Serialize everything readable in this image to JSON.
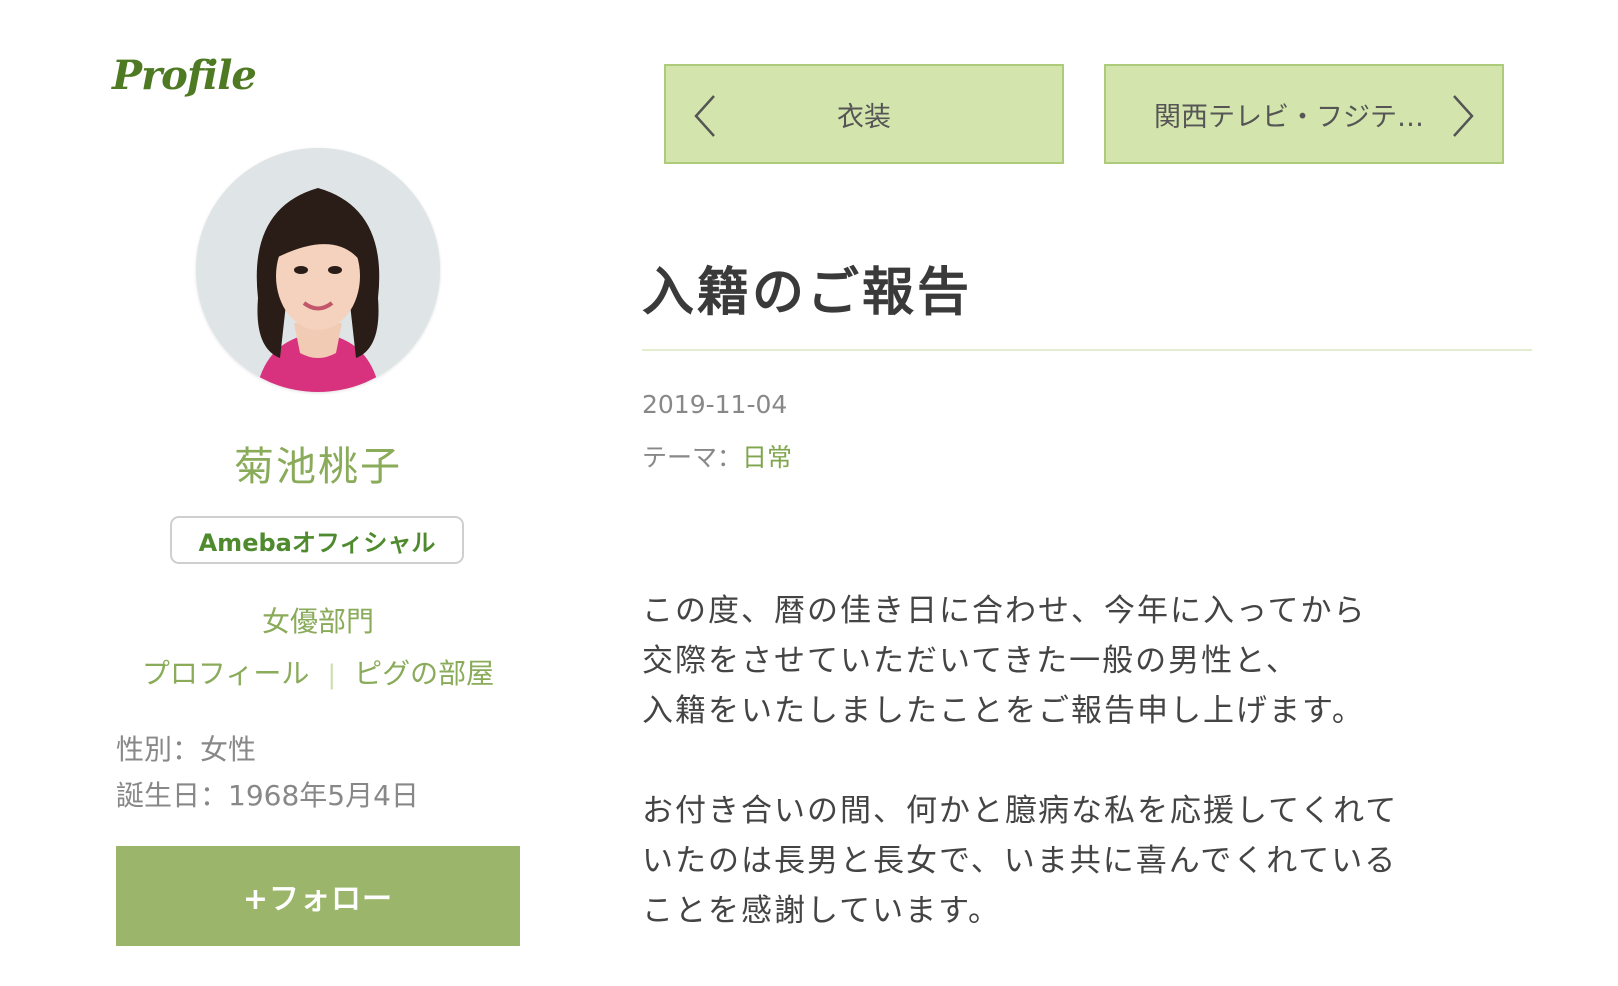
{
  "sidebar": {
    "heading": "Profile",
    "blog_name": "菊池桃子",
    "official_badge": "Amebaオフィシャル",
    "category": "女優部門",
    "links": [
      "プロフィール",
      "ピグの部屋"
    ],
    "gender": "性別：女性",
    "birthday": "誕生日：1968年5月4日",
    "follow_button": "+フォロー"
  },
  "navigation": {
    "prev_title": "衣装",
    "next_title": "関西テレビ・フジテ…",
    "prev_icon": "chevron-left-icon",
    "next_icon": "chevron-right-icon"
  },
  "article": {
    "title": "入籍のご報告",
    "date": "2019-11-04",
    "theme_label": "テーマ：",
    "theme_value": "日常",
    "paragraphs": [
      [
        "この度、暦の佳き日に合わせ、今年に入ってから",
        "交際をさせていただいてきた一般の男性と、",
        "入籍をいたしましたことをご報告申し上げます。"
      ],
      [
        "お付き合いの間、何かと臆病な私を応援してくれて",
        "いたのは長男と長女で、いま共に喜んでくれている",
        "ことを感謝しています。"
      ]
    ]
  },
  "colors": {
    "accent_green": "#8aab5a",
    "dark_green": "#4f7a24",
    "button_green": "#9bb66b",
    "nav_background": "#d3e5ad",
    "nav_border": "#aecb7b"
  }
}
